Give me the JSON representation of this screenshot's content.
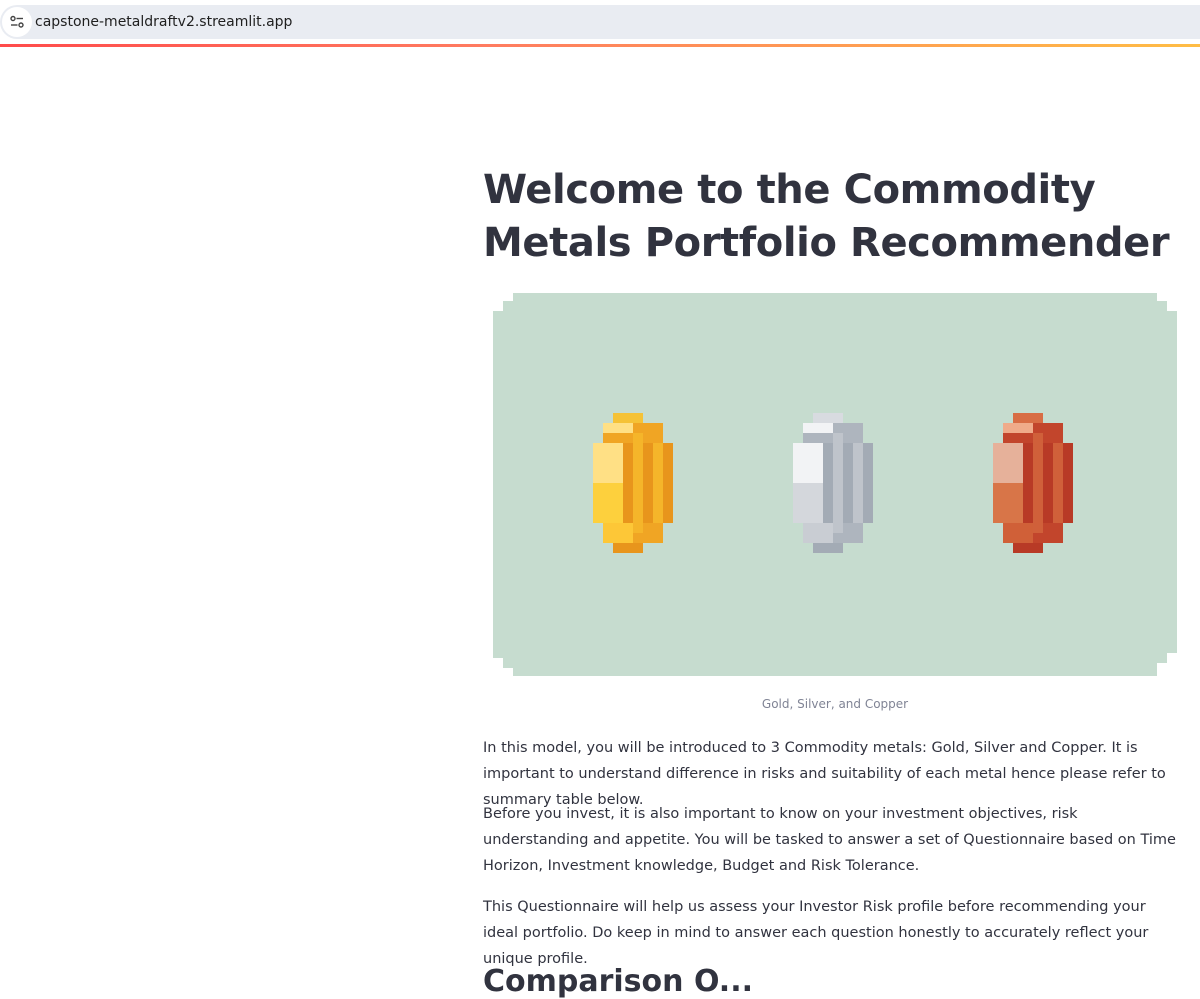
{
  "browser": {
    "url": "capstone-metaldraftv2.streamlit.app",
    "site_icon": "tune-icon"
  },
  "colors": {
    "accent_gradient": [
      "#ff4b4b",
      "#ffbd45"
    ],
    "image_background": "#c6dccf",
    "gold": "#f5b52a",
    "silver": "#b8bec6",
    "copper": "#d0603a"
  },
  "main": {
    "title": "Welcome to the Commodity Metals Portfolio Recommender",
    "image": {
      "icons": [
        "gold-coin-icon",
        "silver-coin-icon",
        "copper-coin-icon"
      ],
      "caption": "Gold, Silver, and Copper"
    },
    "paragraphs": [
      "In this model, you will be introduced to 3 Commodity metals: Gold, Silver and Copper. It is important to understand difference in risks and suitability of each metal hence please refer to summary table below.",
      "Before you invest, it is also important to know on your investment objectives, risk understanding and appetite. You will be tasked to answer a set of Questionnaire based on Time Horizon, Investment knowledge, Budget and Risk Tolerance.",
      "This Questionnaire will help us assess your Investor Risk profile before recommending your ideal portfolio. Do keep in mind to answer each question honestly to accurately reflect your unique profile."
    ],
    "next_heading": "Comparison O..."
  }
}
